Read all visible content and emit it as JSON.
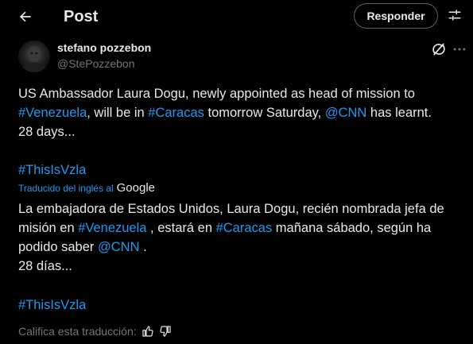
{
  "header": {
    "title": "Post",
    "reply_label": "Responder"
  },
  "author": {
    "name": "stefano pozzebon",
    "handle": "@StePozzebon"
  },
  "tweet": {
    "p1": "US Ambassador Laura Dogu, newly appointed as head of mission to ",
    "tag_venezuela": "#Venezuela",
    "p2": ", will be in ",
    "tag_caracas": "#Caracas",
    "p3": " tomorrow Saturday, ",
    "mention_cnn": "@CNN",
    "p4": " has learnt.",
    "p5": "28 days...",
    "hashtag": "#ThisIsVzla"
  },
  "translation": {
    "label": "Traducido del inglés al",
    "provider": "Google",
    "p1": "La embajadora de Estados Unidos, Laura Dogu, recién nombrada jefa de misión en ",
    "tag_venezuela": "#Venezuela",
    "p2": " , estará en ",
    "tag_caracas": "#Caracas",
    "p3": " mañana sábado, según ha podido saber ",
    "mention_cnn": "@CNN",
    "p4": " .",
    "p5": "28 días...",
    "hashtag": "#ThisIsVzla",
    "rate_label": "Califica esta traducción:"
  },
  "icons": {
    "back": "arrow-left-icon",
    "filter": "filter-sliders-icon",
    "grok": "grok-icon",
    "more": "more-horizontal-icon",
    "thumb_up": "thumb-up-icon",
    "thumb_down": "thumb-down-icon"
  },
  "colors": {
    "background": "#000000",
    "text": "#e7e9ea",
    "muted": "#71767b",
    "link": "#1d9bf0",
    "border": "#536471"
  }
}
